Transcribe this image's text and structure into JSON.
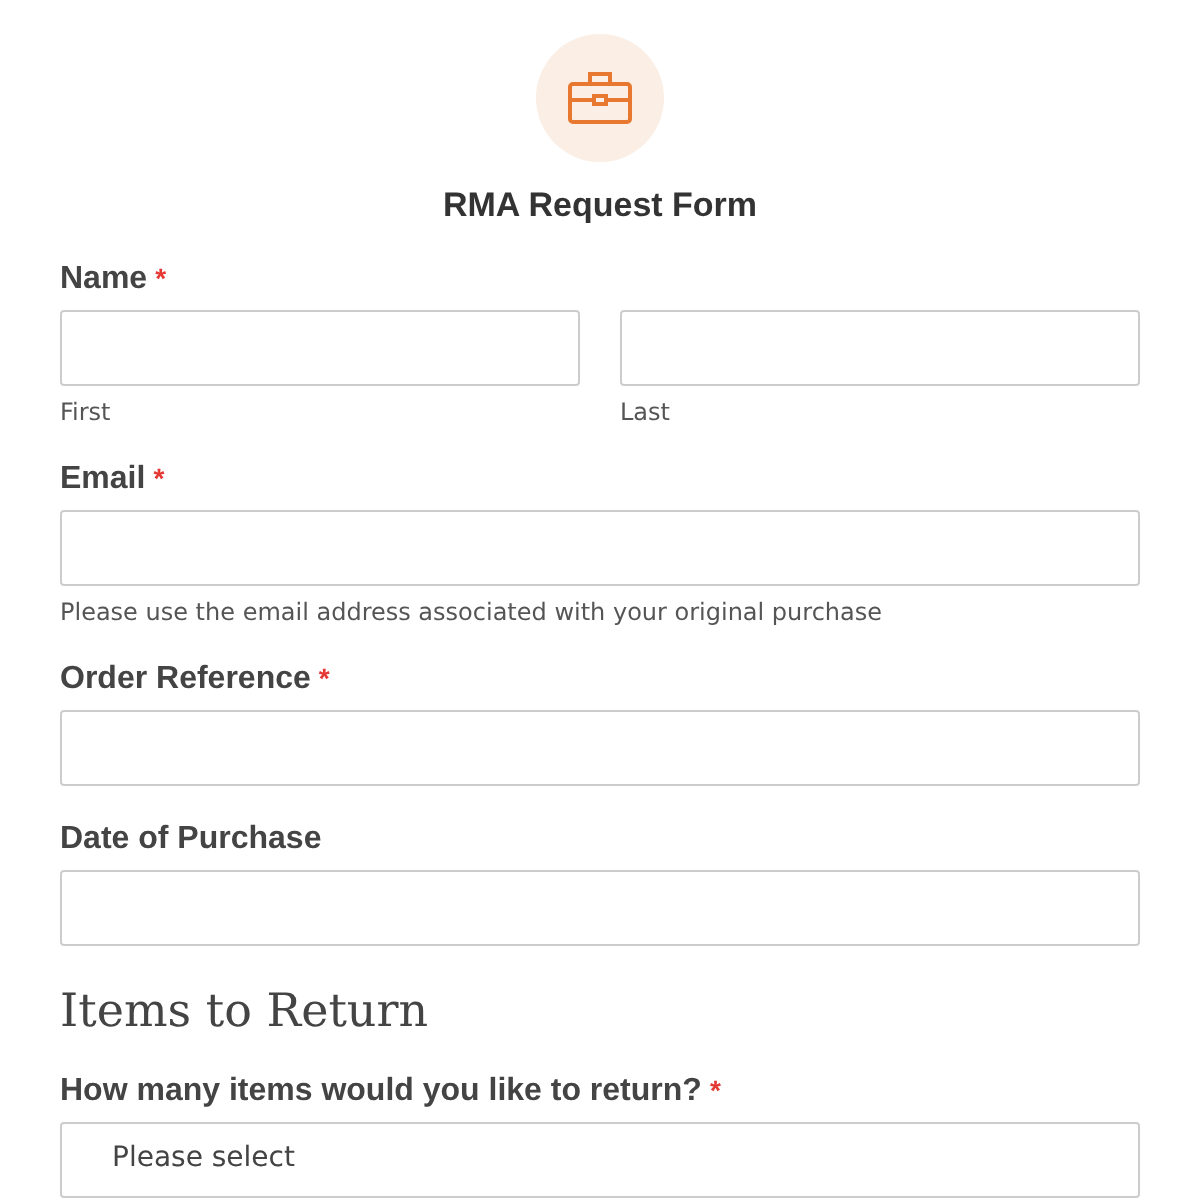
{
  "form": {
    "title": "RMA Request Form"
  },
  "fields": [
    {
      "kind": "name",
      "label": "Name",
      "asterisk": "*",
      "sublabels": [
        "First",
        "Last"
      ]
    },
    {
      "kind": "text",
      "label": "Email",
      "asterisk": "*",
      "help": "Please use the email address associated with your original purchase"
    },
    {
      "kind": "text",
      "label": "Order Reference",
      "asterisk": "*"
    },
    {
      "kind": "text",
      "label": "Date of Purchase"
    },
    {
      "kind": "section",
      "label": "Items to Return"
    },
    {
      "kind": "select",
      "label": "How many items would you like to return?",
      "asterisk": "*",
      "placeholder": "Please select"
    }
  ]
}
